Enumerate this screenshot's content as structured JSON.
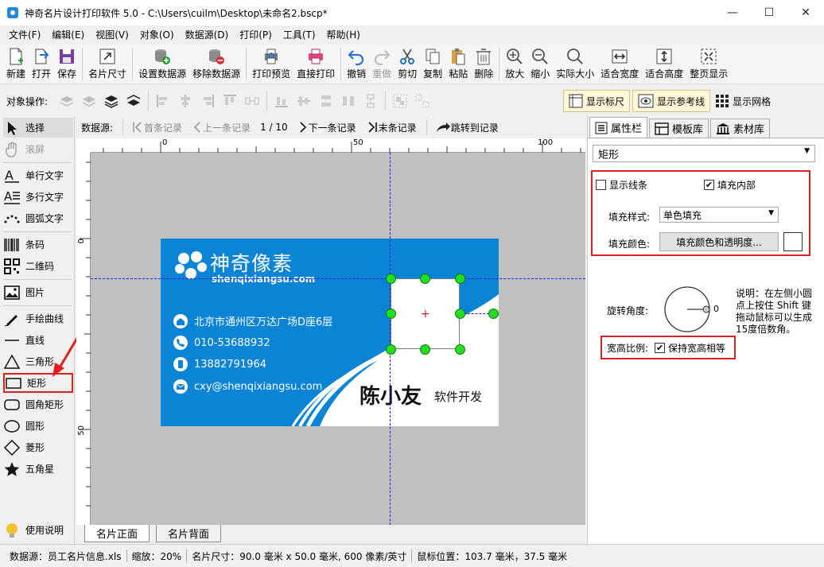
{
  "window": {
    "title": "神奇名片设计打印软件 5.0 - C:\\Users\\cuilm\\Desktop\\未命名2.bscp*",
    "minimize": "—",
    "maximize": "☐",
    "close": "✕"
  },
  "menu": [
    "文件(F)",
    "编辑(E)",
    "视图(V)",
    "对象(O)",
    "数据源(D)",
    "打印(P)",
    "工具(T)",
    "帮助(H)"
  ],
  "toolbar": {
    "new": "新建",
    "open": "打开",
    "save": "保存",
    "card_size": "名片尺寸",
    "set_datasource": "设置数据源",
    "remove_datasource": "移除数据源",
    "print_preview": "打印预览",
    "direct_print": "直接打印",
    "undo": "撤销",
    "redo": "重做",
    "cut": "剪切",
    "copy": "复制",
    "paste": "粘贴",
    "delete": "删除",
    "zoom_in": "放大",
    "zoom_out": "缩小",
    "actual_size": "实际大小",
    "fit_width": "适合宽度",
    "fit_height": "适合高度",
    "fit_page": "整页显示"
  },
  "objbar": {
    "label": "对象操作:",
    "show_ruler": "显示标尺",
    "show_guides": "显示参考线",
    "show_grid": "显示网格"
  },
  "tools": {
    "select": "选择",
    "scroll": "滚屏",
    "single_text": "单行文字",
    "multi_text": "多行文字",
    "arc_text": "圆弧文字",
    "barcode": "条码",
    "qrcode": "二维码",
    "image": "图片",
    "freehand": "手绘曲线",
    "line": "直线",
    "triangle": "三角形",
    "rectangle": "矩形",
    "rounded_rect": "圆角矩形",
    "circle": "圆形",
    "diamond": "菱形",
    "star": "五角星",
    "help": "使用说明"
  },
  "nav": {
    "label": "数据源:",
    "first": "首条记录",
    "prev": "上一条记录",
    "counter": "1 / 10",
    "next": "下一条记录",
    "last": "末条记录",
    "jump": "跳转到记录"
  },
  "ruler": {
    "h": [
      "0",
      "50",
      "100"
    ],
    "v": [
      "0",
      "50"
    ]
  },
  "card": {
    "brand": "神奇像素",
    "domain": "shenqixiangsu.com",
    "address": "北京市通州区万达广场D座6层",
    "phone": "010-53688932",
    "mobile": "13882791964",
    "email": "cxy@shenqixiangsu.com",
    "name": "陈小友",
    "job": "软件开发",
    "blue": "#0b84d6"
  },
  "tabs_bottom": {
    "front": "名片正面",
    "back": "名片背面"
  },
  "panel": {
    "tab_props": "属性栏",
    "tab_templates": "模板库",
    "tab_assets": "素材库",
    "shape": "矩形",
    "show_border": "显示线条",
    "fill_inside": "填充内部",
    "fill_style_label": "填充样式:",
    "fill_style_value": "单色填充",
    "fill_color_label": "填充颜色:",
    "fill_color_btn": "填充颜色和透明度...",
    "rotation_label": "旋转角度:",
    "rotation_value": "0",
    "rotation_note": "说明：在左侧小圆点上按住 Shift 键拖动鼠标可以生成15度倍数角。",
    "aspect_label": "宽高比例:",
    "aspect_keep": "保持宽高相等"
  },
  "status": {
    "datasource": "数据源：员工名片信息.xls",
    "zoom": "缩放：20%",
    "size": "名片尺寸：90.0 毫米 x 50.0 毫米, 600 像素/英寸",
    "mouse": "鼠标位置：103.7 毫米，37.5 毫米"
  }
}
